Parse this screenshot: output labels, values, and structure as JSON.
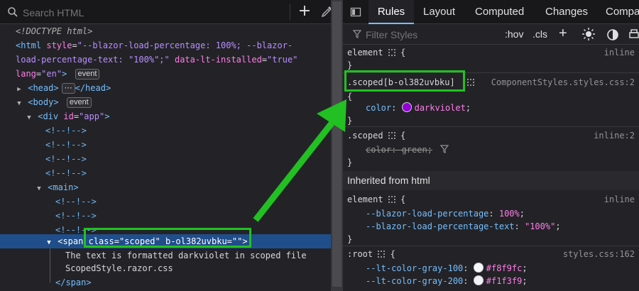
{
  "inspector": {
    "search_placeholder": "Search HTML",
    "markup": {
      "doctype": "<!DOCTYPE html>",
      "html_attr_style_name": "style",
      "html_attr_style_value_1": "\"--blazor-load-percentage: 100%; --blazor-",
      "html_attr_style_value_2": "load-percentage-text: \"100%\";\"",
      "html_attr_lt_name": "data-lt-installed",
      "html_attr_lt_value": "\"true\"",
      "html_attr_lang_name": "lang",
      "html_attr_lang_value": "\"en\"",
      "event_badge": "event",
      "head_tag": "<head>",
      "head_close": "</head>",
      "ellipsis_badge": "⋯",
      "body_tag": "<body>",
      "div_tag_open": "<div",
      "div_id_name": "id",
      "div_id_value": "\"app\"",
      "div_tag_close": ">",
      "comment": "<!--!-->",
      "main_tag": "<main>",
      "span_tag_open": "<span",
      "span_attr_class": "class=\"scoped\"",
      "span_attr_scope": "b-ol382uvbku=\"\"",
      "span_tag_close": ">",
      "span_text_1": "The text is formatted darkviolet in scoped file",
      "span_text_2": "ScopedStyle.razor.css",
      "span_close": "</span>"
    }
  },
  "rules_panel": {
    "tabs": [
      "Rules",
      "Layout",
      "Computed",
      "Changes",
      "Compa"
    ],
    "active_tab": "Rules",
    "filter_placeholder": "Filter Styles",
    "hov_label": ":hov",
    "cls_label": ".cls",
    "rules": {
      "element_selector": "element",
      "inline_label": "inline",
      "scoped_selector": ".scoped[b-ol382uvbku]",
      "scoped_source": "ComponentStyles.styles.css:2",
      "color_prop": "color",
      "darkviolet_value": "darkviolet",
      "scoped2_selector": ".scoped",
      "scoped2_source": "inline:2",
      "green_decl": "color: green;",
      "inherited_header": "Inherited from html",
      "element2_selector": "element",
      "element2_source": "inline",
      "blazor_pct_prop": "--blazor-load-percentage",
      "blazor_pct_value": "100%",
      "blazor_pct_text_prop": "--blazor-load-percentage-text",
      "blazor_pct_text_value": "\"100%\"",
      "root_selector": ":root",
      "root_source": "styles.css:162",
      "gray100_prop": "--lt-color-gray-100",
      "gray100_value": "#f8f9fc",
      "gray200_prop": "--lt-color-gray-200",
      "gray200_value": "#f1f3f9",
      "open_brace": "{",
      "close_brace": "}",
      "colon": ":",
      "semicolon": ";"
    }
  },
  "colors": {
    "highlight": "#22c022",
    "darkviolet": "#9400d3",
    "selection": "#204e8a"
  }
}
